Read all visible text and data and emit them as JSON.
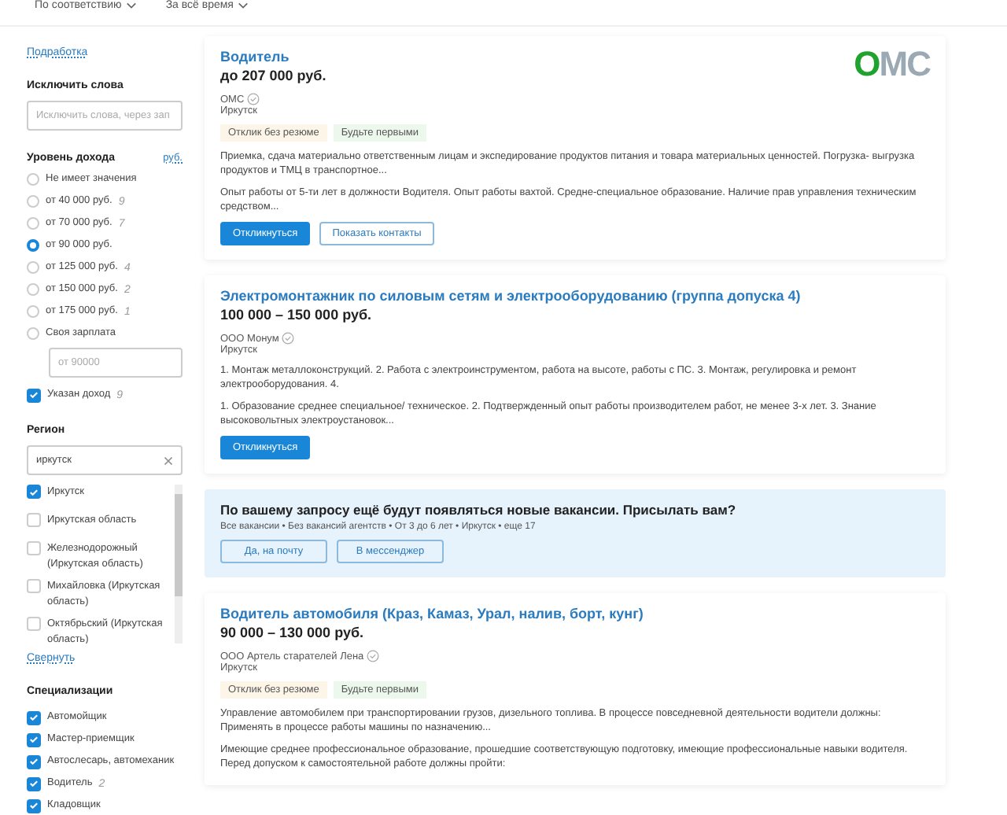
{
  "sort_controls": [
    {
      "label": "По соответствию"
    },
    {
      "label": "За всё время"
    }
  ],
  "sidebar": {
    "part_time_link": "Подработка",
    "exclude": {
      "title": "Исключить слова",
      "placeholder": "Исключить слова, через зап"
    },
    "income": {
      "title": "Уровень дохода",
      "currency_link": "руб.",
      "options": [
        {
          "label": "Не имеет значения",
          "selected": false
        },
        {
          "label": "от 40 000 руб.",
          "count": "9",
          "selected": false
        },
        {
          "label": "от 70 000 руб.",
          "count": "7",
          "selected": false
        },
        {
          "label": "от 90 000 руб.",
          "selected": true
        },
        {
          "label": "от 125 000 руб.",
          "count": "4",
          "selected": false
        },
        {
          "label": "от 150 000 руб.",
          "count": "2",
          "selected": false
        },
        {
          "label": "от 175 000 руб.",
          "count": "1",
          "selected": false
        },
        {
          "label": "Своя зарплата",
          "selected": false
        }
      ],
      "custom_placeholder": "от 90000",
      "specified": {
        "label": "Указан доход",
        "count": "9",
        "checked": true
      }
    },
    "region": {
      "title": "Регион",
      "search_value": "иркутск",
      "items": [
        {
          "label": "Иркутск",
          "checked": true
        },
        {
          "label": "Иркутская область",
          "checked": false
        },
        {
          "label": "Железнодорожный (Иркутская область)",
          "checked": false
        },
        {
          "label": "Михайловка (Иркутская область)",
          "checked": false
        },
        {
          "label": "Октябрьский (Иркутская область)",
          "checked": false
        }
      ],
      "collapse_link": "Свернуть"
    },
    "specializations": {
      "title": "Специализации",
      "items": [
        {
          "label": "Автомойщик",
          "checked": true
        },
        {
          "label": "Мастер-приемщик",
          "checked": true
        },
        {
          "label": "Автослесарь, автомеханик",
          "checked": true
        },
        {
          "label": "Водитель",
          "count": "2",
          "checked": true
        },
        {
          "label": "Кладовщик",
          "checked": true
        }
      ]
    }
  },
  "feed": [
    {
      "kind": "vacancy",
      "title": "Водитель",
      "salary": "до 207 000 руб.",
      "company": "ОМС",
      "logo": "ОМС",
      "city": "Иркутск",
      "tags": [
        {
          "label": "Отклик без резюме",
          "kind": "warm"
        },
        {
          "label": "Будьте первыми",
          "kind": "green"
        }
      ],
      "paragraphs": [
        "Приемка, сдача материально ответственным лицам и экспедирование продуктов питания и товара материальных ценностей. Погрузка- выгрузка продуктов и ТМЦ в транспортное...",
        "Опыт работы от 5-ти лет в должности Водителя. Опыт работы вахтой. Средне-специальное образование. Наличие прав управления техническим средством..."
      ],
      "buttons": [
        {
          "label": "Откликнуться",
          "kind": "primary"
        },
        {
          "label": "Показать контакты",
          "kind": "outline"
        }
      ]
    },
    {
      "kind": "vacancy",
      "title": "Электромонтажник по силовым сетям и электрооборудованию (группа допуска 4)",
      "salary": "100 000 – 150 000 руб.",
      "company": "ООО Монум",
      "city": "Иркутск",
      "paragraphs": [
        "1. Монтаж металлоконструкций. 2. Работа с электроинструментом, работа на высоте, работы с ПС. 3. Монтаж, регулировка и ремонт электрооборудования. 4.",
        "1. Образование среднее специальное/ техническое. 2. Подтвержденный опыт работы производителем работ, не менее 3-х лет. 3. Знание высоковольтных электроустановок..."
      ],
      "buttons": [
        {
          "label": "Откликнуться",
          "kind": "primary"
        }
      ]
    },
    {
      "kind": "subscribe",
      "title": "По вашему запросу ещё будут появляться новые вакансии. Присылать вам?",
      "summary": "Все вакансии • Без вакансий агентств • От 3 до 6 лет • Иркутск • еще 17",
      "buttons": [
        {
          "label": "Да, на почту",
          "kind": "outline"
        },
        {
          "label": "В мессенджер",
          "kind": "outline"
        }
      ]
    },
    {
      "kind": "vacancy",
      "title": "Водитель автомобиля (Краз, Камаз, Урал, налив, борт, кунг)",
      "salary": "90 000 – 130 000 руб.",
      "company": "ООО Артель старателей Лена",
      "city": "Иркутск",
      "tags": [
        {
          "label": "Отклик без резюме",
          "kind": "warm"
        },
        {
          "label": "Будьте первыми",
          "kind": "green"
        }
      ],
      "paragraphs": [
        "Управление автомобилем при транспортировании грузов, дизельного топлива. В процессе повседневной деятельности водители должны: Применять в процессе работы машины по назначению...",
        "Имеющие среднее профессиональное образование, прошедшие соответствующую подготовку, имеющие профессиональные навыки водителя. Перед допуском к самостоятельной работе должны пройти:"
      ]
    }
  ]
}
